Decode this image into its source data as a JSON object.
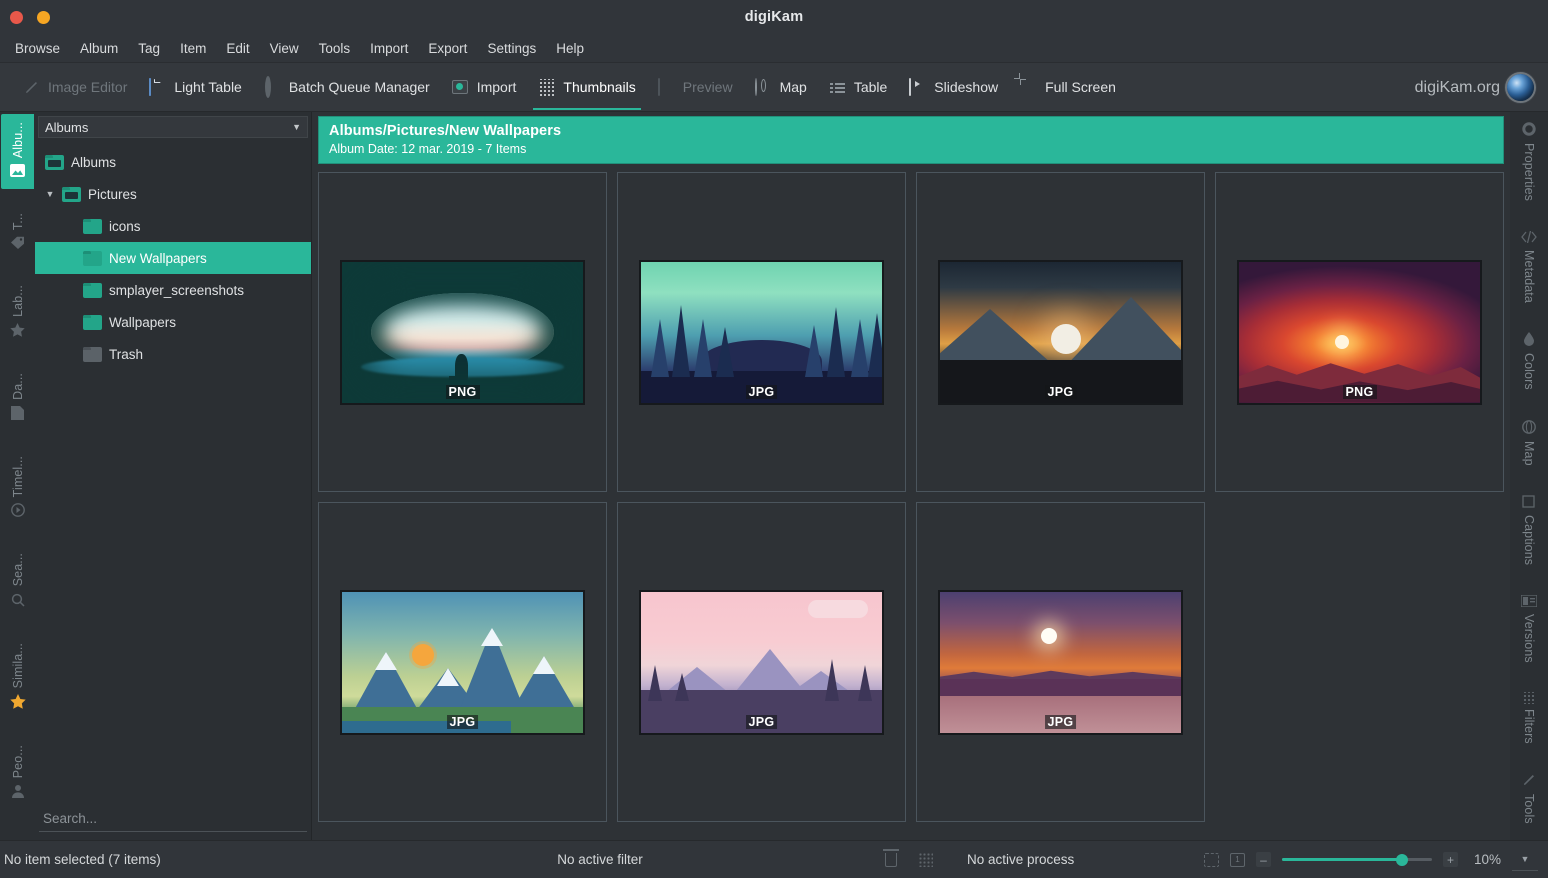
{
  "window": {
    "title": "digiKam"
  },
  "menubar": {
    "items": [
      "Browse",
      "Album",
      "Tag",
      "Item",
      "Edit",
      "View",
      "Tools",
      "Import",
      "Export",
      "Settings",
      "Help"
    ]
  },
  "toolbar": {
    "items": [
      {
        "label": "Image Editor",
        "icon": "pencil-icon",
        "state": "dim"
      },
      {
        "label": "Light Table",
        "icon": "light-table-icon",
        "state": "normal"
      },
      {
        "label": "Batch Queue Manager",
        "icon": "gear-icon",
        "state": "normal"
      },
      {
        "label": "Import",
        "icon": "import-icon",
        "state": "normal"
      },
      {
        "label": "Thumbnails",
        "icon": "grid-dots-icon",
        "state": "active"
      },
      {
        "label": "Preview",
        "icon": "preview-icon",
        "state": "dim"
      },
      {
        "label": "Map",
        "icon": "globe-icon",
        "state": "normal"
      },
      {
        "label": "Table",
        "icon": "list-icon",
        "state": "normal"
      },
      {
        "label": "Slideshow",
        "icon": "play-icon",
        "state": "normal"
      },
      {
        "label": "Full Screen",
        "icon": "fullscreen-icon",
        "state": "normal"
      }
    ],
    "brand": "digiKam.org"
  },
  "left_strip": {
    "tabs": [
      {
        "label": "Albu...",
        "icon": "album-icon",
        "selected": true
      },
      {
        "label": "T...",
        "icon": "tag-icon",
        "selected": false
      },
      {
        "label": "Lab...",
        "icon": "star-icon",
        "selected": false
      },
      {
        "label": "Da...",
        "icon": "date-icon",
        "selected": false
      },
      {
        "label": "Timel...",
        "icon": "timeline-icon",
        "selected": false
      },
      {
        "label": "Sea...",
        "icon": "search-icon",
        "selected": false
      },
      {
        "label": "Simila...",
        "icon": "fuzzy-star-icon",
        "selected": false
      },
      {
        "label": "Peo...",
        "icon": "people-icon",
        "selected": false
      }
    ]
  },
  "left_panel": {
    "combo": {
      "value": "Albums",
      "caret": "▼"
    },
    "tree": [
      {
        "label": "Albums",
        "depth": 0,
        "icon": "albums-root-icon",
        "expander": "",
        "selected": false
      },
      {
        "label": "Pictures",
        "depth": 1,
        "icon": "folder-open-icon",
        "expander": "▼",
        "selected": false
      },
      {
        "label": "icons",
        "depth": 2,
        "icon": "folder-icon",
        "expander": "",
        "selected": false
      },
      {
        "label": "New Wallpapers",
        "depth": 2,
        "icon": "folder-icon",
        "expander": "",
        "selected": true
      },
      {
        "label": "smplayer_screenshots",
        "depth": 2,
        "icon": "folder-icon",
        "expander": "",
        "selected": false
      },
      {
        "label": "Wallpapers",
        "depth": 2,
        "icon": "folder-icon",
        "expander": "",
        "selected": false
      },
      {
        "label": "Trash",
        "depth": 2,
        "icon": "trash-icon",
        "expander": "",
        "selected": false
      }
    ],
    "search": {
      "placeholder": "Search...",
      "value": ""
    }
  },
  "album_header": {
    "path": "Albums/Pictures/New Wallpapers",
    "subtitle": "Album Date: 12 mar. 2019 - 7 Items",
    "accent": "#2ab79a"
  },
  "thumbnails": [
    {
      "format": "PNG",
      "art": "cave"
    },
    {
      "format": "JPG",
      "art": "forest"
    },
    {
      "format": "JPG",
      "art": "moon"
    },
    {
      "format": "PNG",
      "art": "red"
    },
    {
      "format": "JPG",
      "art": "green"
    },
    {
      "format": "JPG",
      "art": "pink"
    },
    {
      "format": "JPG",
      "art": "lake"
    }
  ],
  "right_strip": {
    "tabs": [
      {
        "label": "Properties",
        "icon": "gear-icon"
      },
      {
        "label": "Metadata",
        "icon": "code-icon"
      },
      {
        "label": "Colors",
        "icon": "droplet-icon"
      },
      {
        "label": "Map",
        "icon": "globe-icon"
      },
      {
        "label": "Captions",
        "icon": "caption-icon"
      },
      {
        "label": "Versions",
        "icon": "versions-icon"
      },
      {
        "label": "Filters",
        "icon": "filters-icon"
      },
      {
        "label": "Tools",
        "icon": "pencil-icon"
      }
    ]
  },
  "statusbar": {
    "selection": "No item selected (7 items)",
    "filter": "No active filter",
    "process": "No active process",
    "zoom_value": "10%",
    "zoom_minus": "–",
    "zoom_plus": "+",
    "zoom_caret": "▼"
  }
}
